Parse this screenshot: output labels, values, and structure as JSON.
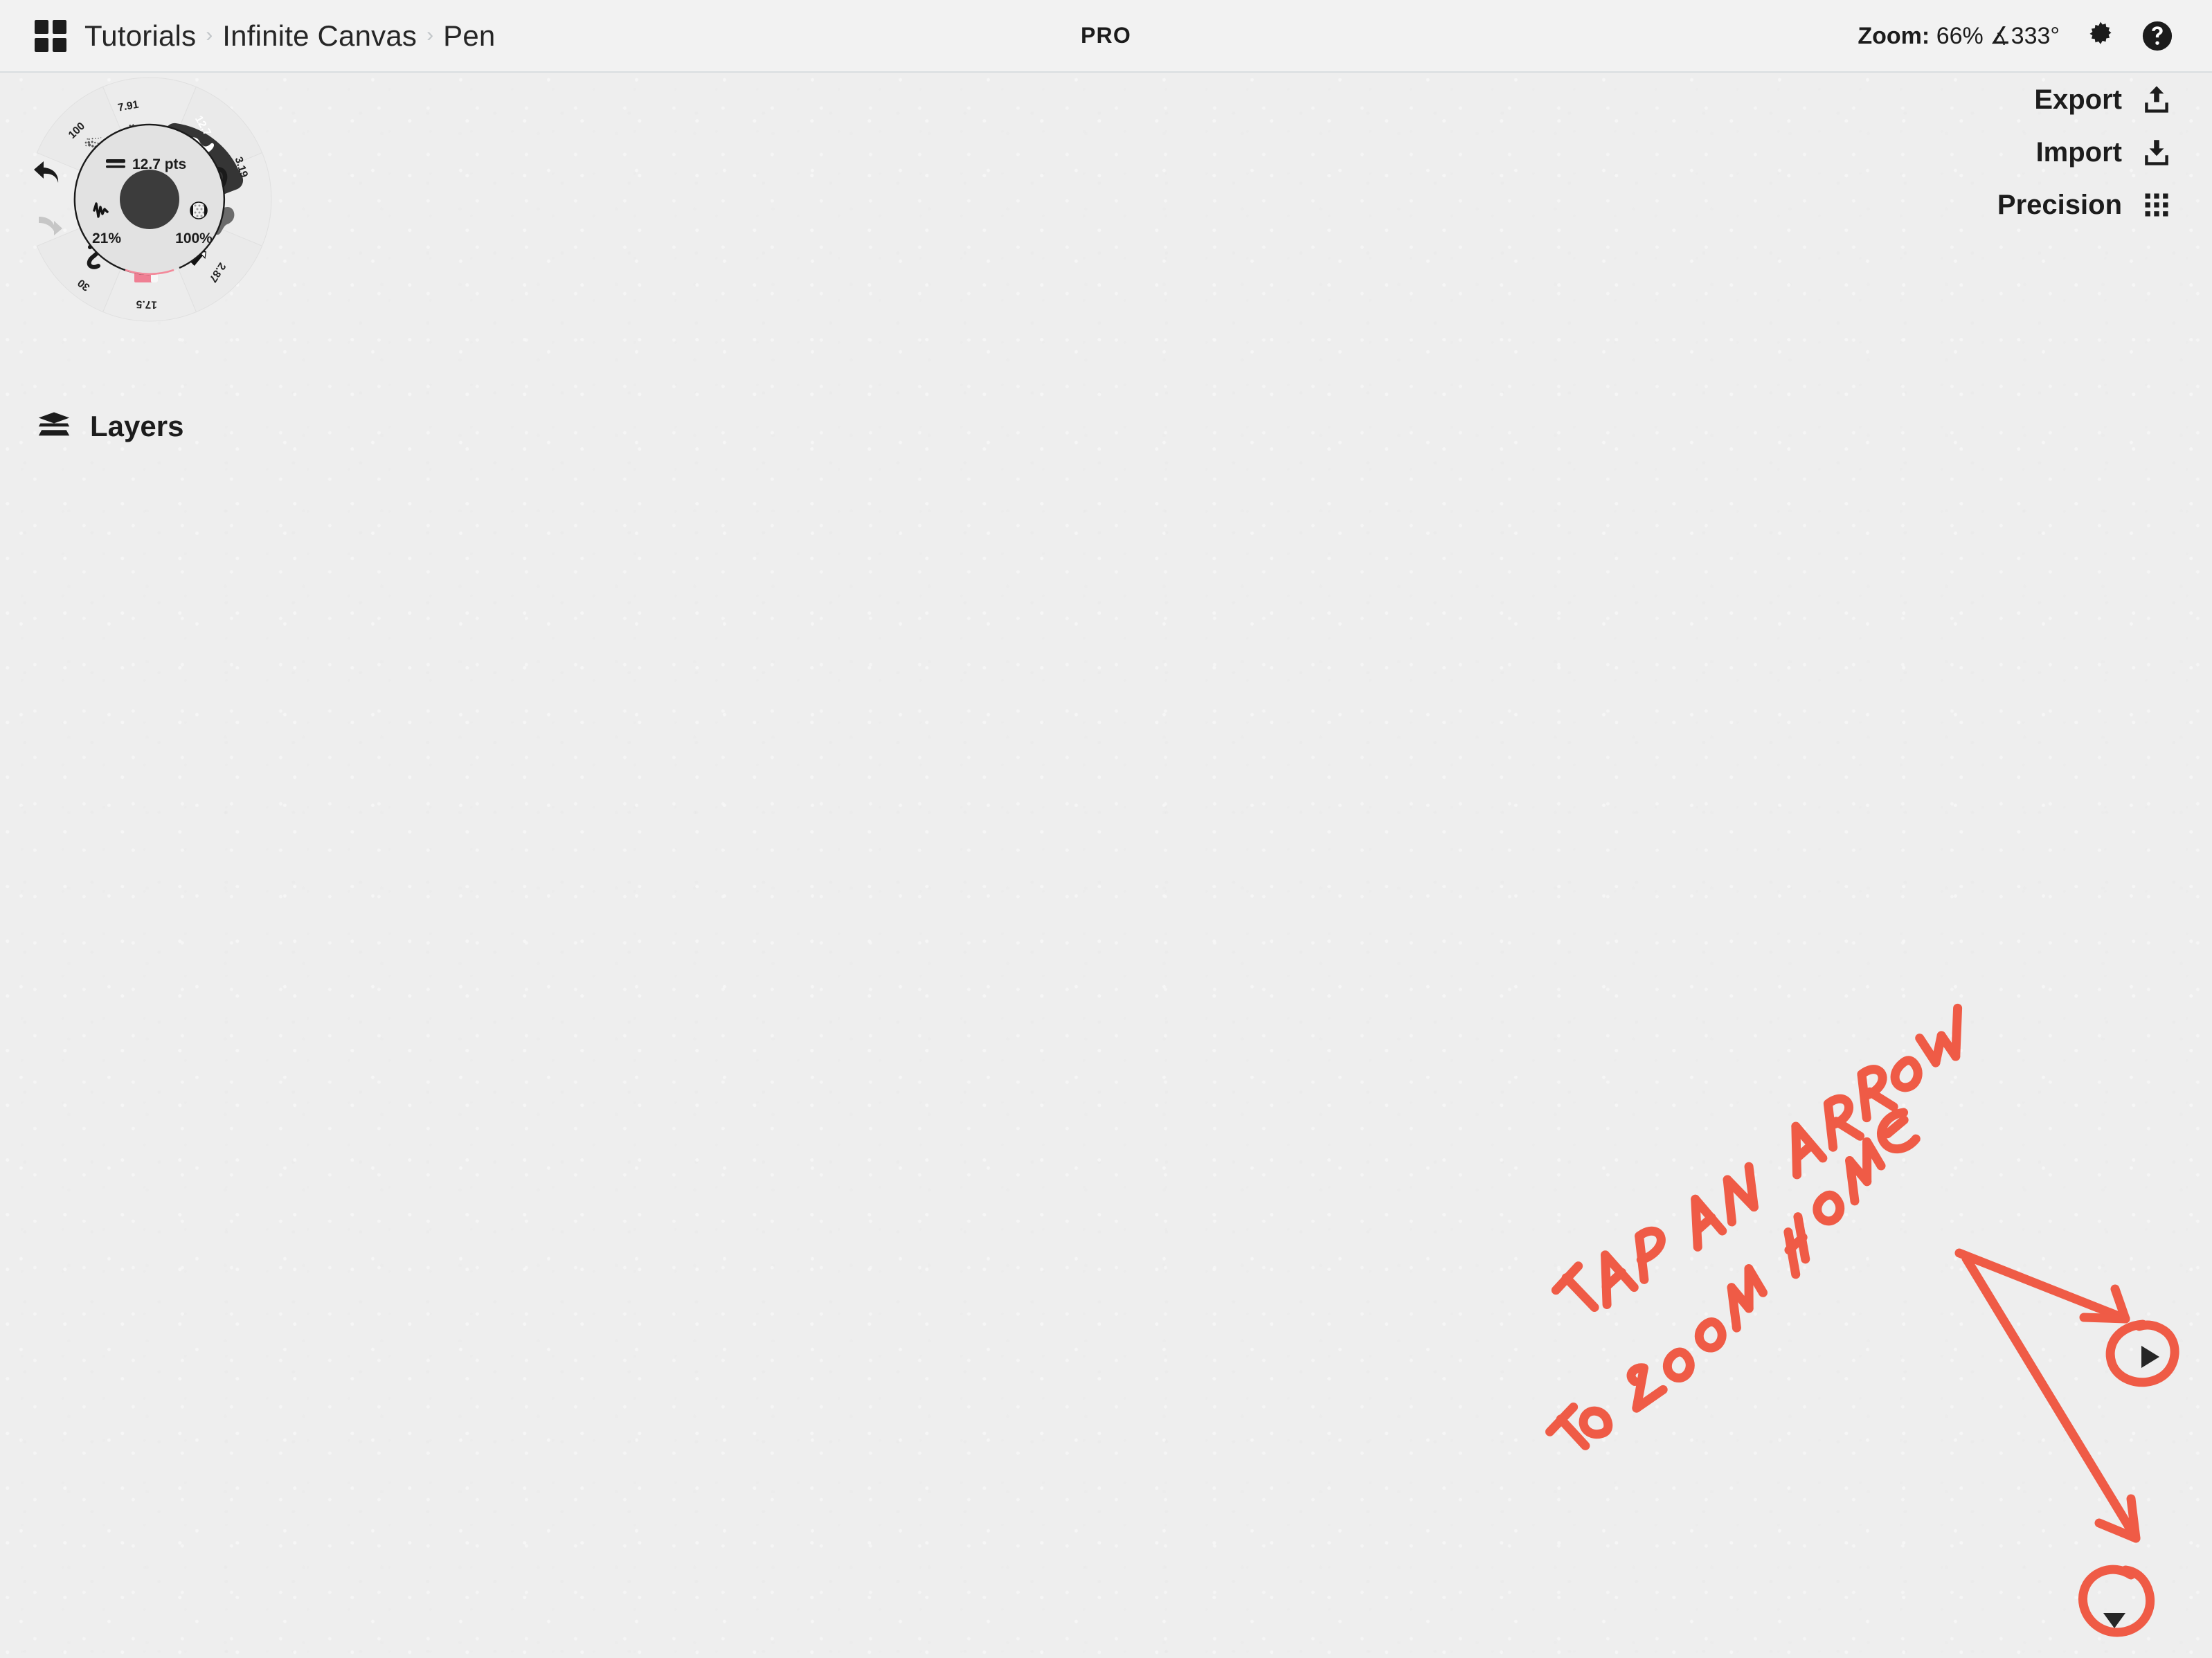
{
  "app": {
    "background_color": "#eeeeee",
    "accent_color": "#ef5b46",
    "ink_color": "#1c1c1c"
  },
  "topbar": {
    "grid_icon": "grid-apps-icon",
    "breadcrumb": [
      {
        "label": "Tutorials"
      },
      {
        "label": "Infinite Canvas"
      },
      {
        "label": "Pen"
      }
    ],
    "separator": "›",
    "center_badge": "PRO",
    "zoom": {
      "prefix": "Zoom:",
      "percent": "66%",
      "angle": "∡333°",
      "value": "66% ∡333°"
    },
    "settings_icon": "gear-icon",
    "help_icon": "help-circle-icon"
  },
  "actions": [
    {
      "label": "Export",
      "icon": "upload-icon"
    },
    {
      "label": "Import",
      "icon": "download-icon"
    },
    {
      "label": "Precision",
      "icon": "dot-grid-icon"
    }
  ],
  "layers_panel": {
    "label": "Layers",
    "icon": "layers-stack-icon"
  },
  "brush_wheel": {
    "center": {
      "size_label": "12.7 pts",
      "size_icon": "stroke-weight-icon",
      "jitter_icon": "jitter-wave-icon",
      "jitter_value": "21%",
      "opacity_icon": "opacity-half-circle-icon",
      "opacity_value": "100%"
    },
    "segments": [
      {
        "label": "100",
        "preview": "spray-speckle-brush",
        "selected": false
      },
      {
        "label": "7.91",
        "preview": "dense-speckle-brush",
        "selected": false
      },
      {
        "label": "12.7",
        "preview": "thick-wave-brush",
        "selected": true
      },
      {
        "label": "3.19",
        "preview": "thin-wave-brush",
        "selected": false
      },
      {
        "label": "",
        "preview": "gray-chisel-brush",
        "selected": false
      },
      {
        "label": "2.87",
        "preview": "black-gradient-wedge",
        "selected": false
      },
      {
        "label": "17.5",
        "preview": "pink-color-swatch",
        "selected": false
      },
      {
        "label": "30",
        "preview": "squiggle-brush",
        "selected": false
      }
    ],
    "undo_icon": "undo-arrow-icon",
    "redo_icon": "redo-arrow-icon",
    "undo_enabled": "enabled",
    "redo_enabled": "disabled",
    "swatch_color": "#ef7f93"
  },
  "canvas_annotation": {
    "handwritten_text": "TAP AN ARROW TO ZOOM HOME",
    "line_1": "TAP AN ARROW",
    "line_2": "TO ZOOM HOME",
    "ink_color": "#ef5b46",
    "circled_controls": [
      {
        "name": "zoom-home-right-arrow",
        "glyph": "▶"
      },
      {
        "name": "zoom-home-down-arrow",
        "glyph": "▼"
      }
    ]
  }
}
